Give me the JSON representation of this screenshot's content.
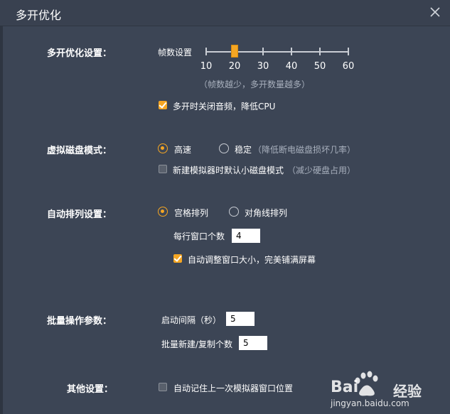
{
  "window": {
    "title": "多开优化"
  },
  "multi": {
    "label": "多开优化设置：",
    "frame_label": "帧数设置",
    "ticks": [
      "10",
      "20",
      "30",
      "40",
      "50",
      "60"
    ],
    "frame_value": 20,
    "hint": "（帧数越少，多开数量越多）",
    "mute_label": "多开时关闭音频，降低CPU",
    "mute_checked": true
  },
  "disk": {
    "label": "虚拟磁盘模式：",
    "fast": "高速",
    "stable": "稳定",
    "stable_hint": "（降低断电磁盘损坏几率）",
    "selected": "高速",
    "small_disk_label": "新建模拟器时默认小磁盘模式",
    "small_disk_hint": "（减少硬盘占用）",
    "small_disk_checked": false
  },
  "arrange": {
    "label": "自动排列设置：",
    "grid": "宫格排列",
    "diagonal": "对角线排列",
    "selected": "宫格排列",
    "per_row_label": "每行窗口个数",
    "per_row_value": "4",
    "auto_resize_label": "自动调整窗口大小，完美铺满屏幕",
    "auto_resize_checked": true
  },
  "batch": {
    "label": "批量操作参数：",
    "interval_label": "启动间隔（秒）",
    "interval_value": "5",
    "count_label": "批量新建/复制个数",
    "count_value": "5"
  },
  "other": {
    "label": "其他设置：",
    "remember_label": "自动记住上一次模拟器窗口位置",
    "remember_checked": false
  },
  "watermark": {
    "brand": "Bai",
    "brand2": "经验",
    "url": "jingyan.baidu.com"
  },
  "colors": {
    "accent": "#f5a623",
    "background": "#3c4555"
  },
  "icons": [
    "close-icon",
    "baidu-paw-icon"
  ]
}
